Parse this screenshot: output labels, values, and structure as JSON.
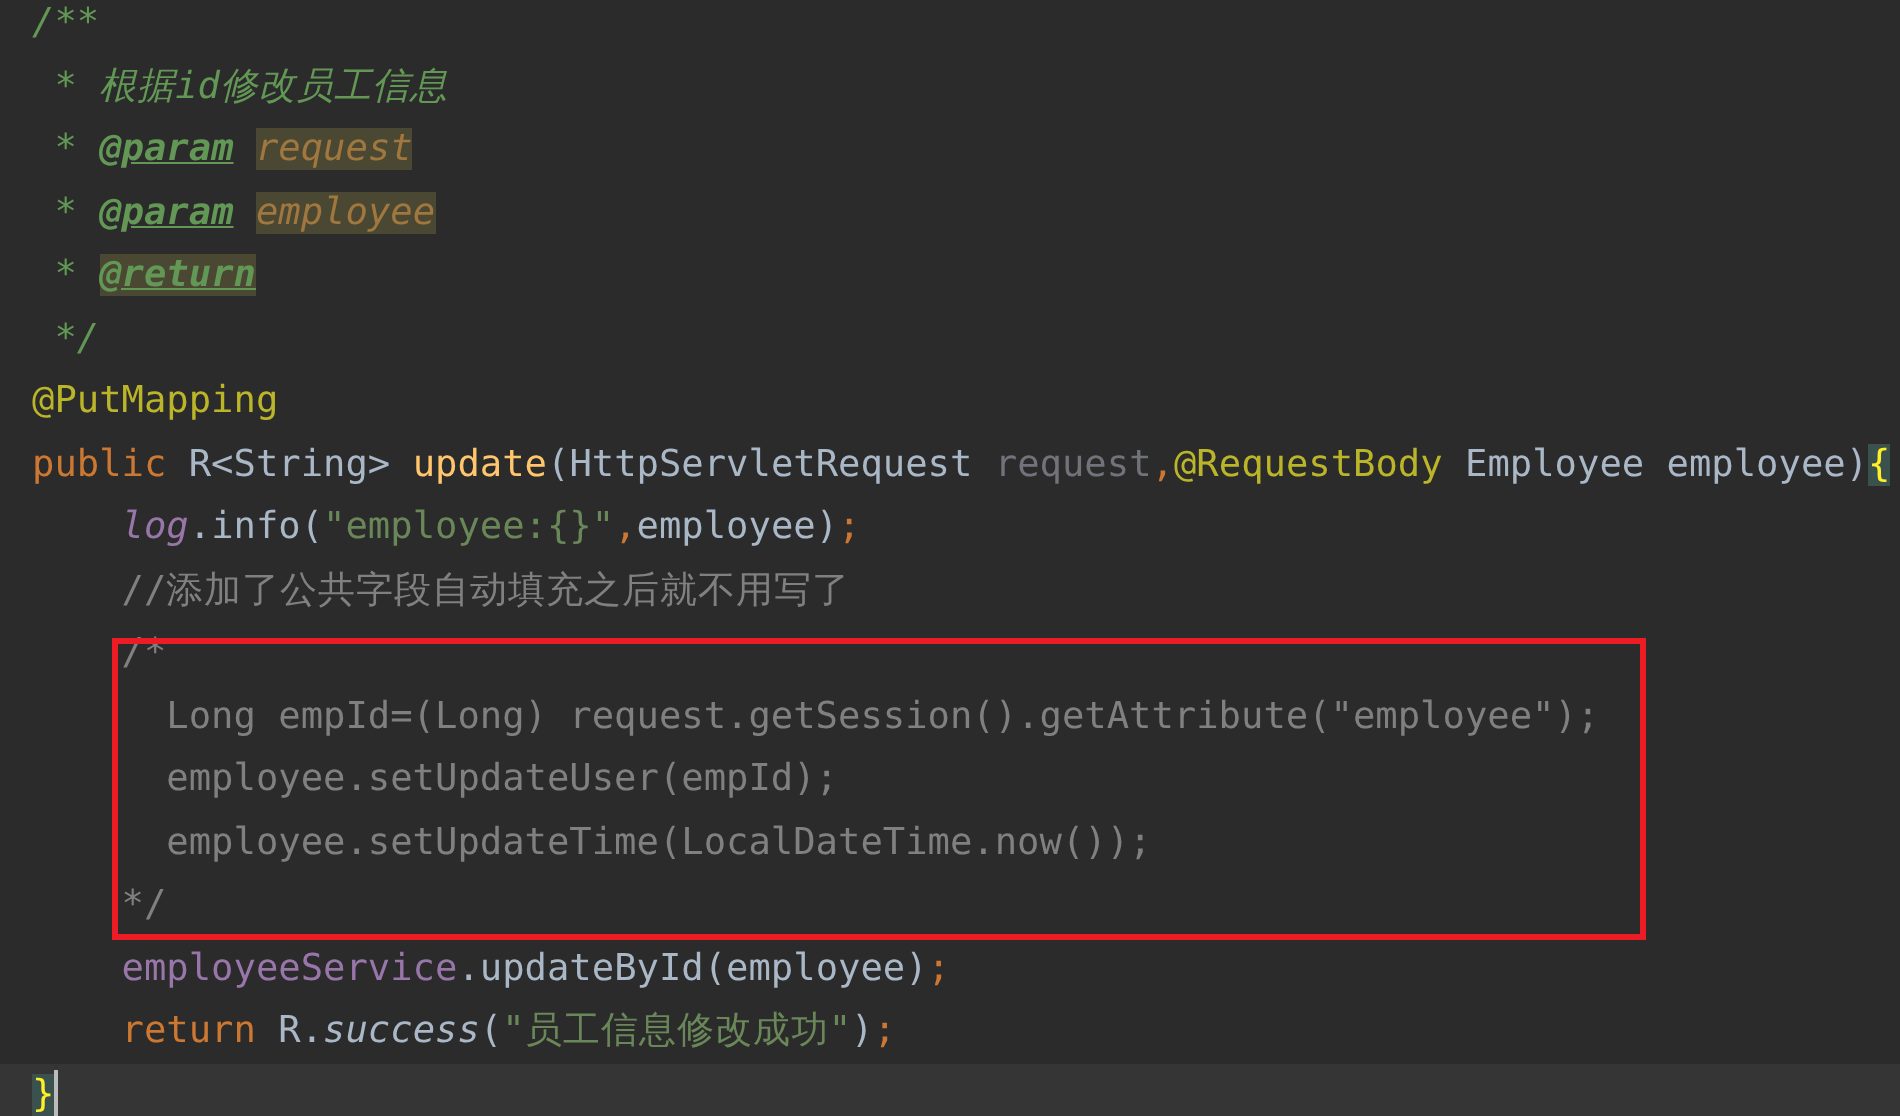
{
  "editor": {
    "lines": [
      {
        "boxed": false,
        "current": false,
        "tokens": [
          {
            "text": "/**",
            "kind": "doc"
          }
        ]
      },
      {
        "boxed": false,
        "current": false,
        "tokens": [
          {
            "text": " * 根据id修改员工信息",
            "kind": "doc"
          }
        ]
      },
      {
        "boxed": false,
        "current": false,
        "tokens": [
          {
            "text": " * ",
            "kind": "doc"
          },
          {
            "text": "@param ",
            "kind": "doc-tag"
          },
          {
            "text": "request",
            "kind": "doc-param-hl"
          }
        ]
      },
      {
        "boxed": false,
        "current": false,
        "tokens": [
          {
            "text": " * ",
            "kind": "doc"
          },
          {
            "text": "@param ",
            "kind": "doc-tag"
          },
          {
            "text": "employee",
            "kind": "doc-param-hl"
          }
        ]
      },
      {
        "boxed": false,
        "current": false,
        "tokens": [
          {
            "text": " * ",
            "kind": "doc"
          },
          {
            "text": "@return",
            "kind": "doc-tag-hl"
          }
        ]
      },
      {
        "boxed": false,
        "current": false,
        "tokens": [
          {
            "text": " */",
            "kind": "doc"
          }
        ]
      },
      {
        "boxed": false,
        "current": false,
        "tokens": [
          {
            "text": "@PutMapping",
            "kind": "annotation"
          }
        ]
      },
      {
        "boxed": false,
        "current": false,
        "tokens": [
          {
            "text": "public",
            "kind": "keyword"
          },
          {
            "text": " R<String> ",
            "kind": "plain"
          },
          {
            "text": "update",
            "kind": "method-decl"
          },
          {
            "text": "(HttpServletRequest ",
            "kind": "plain"
          },
          {
            "text": "request",
            "kind": "unused"
          },
          {
            "text": ",",
            "kind": "keyword"
          },
          {
            "text": "@RequestBody",
            "kind": "annotation"
          },
          {
            "text": " Employee employee)",
            "kind": "plain"
          },
          {
            "text": "{",
            "kind": "brace-match"
          }
        ]
      },
      {
        "boxed": false,
        "current": false,
        "tokens": [
          {
            "text": "    log",
            "kind": "static-field"
          },
          {
            "text": ".info(",
            "kind": "plain"
          },
          {
            "text": "\"employee:{}\"",
            "kind": "string"
          },
          {
            "text": ",",
            "kind": "keyword"
          },
          {
            "text": "employee)",
            "kind": "plain"
          },
          {
            "text": ";",
            "kind": "keyword"
          }
        ]
      },
      {
        "boxed": false,
        "current": false,
        "tokens": [
          {
            "text": "    //添加了公共字段自动填充之后就不用写了",
            "kind": "comment"
          }
        ]
      },
      {
        "boxed": true,
        "current": false,
        "tokens": [
          {
            "text": "    /*",
            "kind": "comment"
          }
        ]
      },
      {
        "boxed": true,
        "current": false,
        "tokens": [
          {
            "text": "      Long empId=(Long) request.getSession().getAttribute(\"employee\");",
            "kind": "comment"
          }
        ]
      },
      {
        "boxed": true,
        "current": false,
        "tokens": [
          {
            "text": "      employee.setUpdateUser(empId);",
            "kind": "comment"
          }
        ]
      },
      {
        "boxed": true,
        "current": false,
        "tokens": [
          {
            "text": "      employee.setUpdateTime(LocalDateTime.now());",
            "kind": "comment"
          }
        ]
      },
      {
        "boxed": true,
        "current": false,
        "tokens": [
          {
            "text": "    */",
            "kind": "comment"
          }
        ]
      },
      {
        "boxed": false,
        "current": false,
        "tokens": [
          {
            "text": "    employeeService",
            "kind": "field"
          },
          {
            "text": ".updateById(employee)",
            "kind": "plain"
          },
          {
            "text": ";",
            "kind": "keyword"
          }
        ]
      },
      {
        "boxed": false,
        "current": false,
        "tokens": [
          {
            "text": "    return",
            "kind": "keyword"
          },
          {
            "text": " R.",
            "kind": "plain"
          },
          {
            "text": "success",
            "kind": "static-call"
          },
          {
            "text": "(",
            "kind": "plain"
          },
          {
            "text": "\"员工信息修改成功\"",
            "kind": "string"
          },
          {
            "text": ")",
            "kind": "plain"
          },
          {
            "text": ";",
            "kind": "keyword"
          }
        ]
      },
      {
        "boxed": false,
        "current": true,
        "tokens": [
          {
            "text": "}",
            "kind": "brace-match"
          }
        ]
      }
    ]
  }
}
